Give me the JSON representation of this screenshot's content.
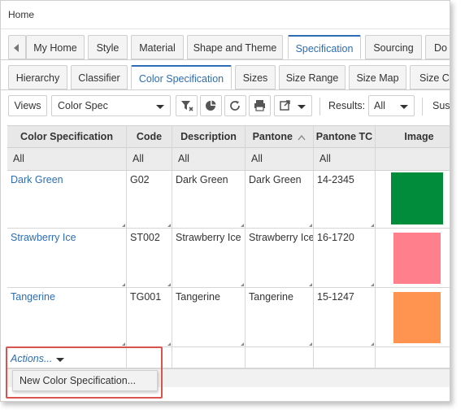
{
  "window": {
    "title": "Home"
  },
  "main_tabs": [
    {
      "label": "",
      "icon": "chevron-left-icon"
    },
    {
      "label": "My Home"
    },
    {
      "label": "Style"
    },
    {
      "label": "Material"
    },
    {
      "label": "Shape and Theme"
    },
    {
      "label": "Specification",
      "active": true
    },
    {
      "label": "Sourcing"
    },
    {
      "label": "Do"
    }
  ],
  "sub_tabs": [
    {
      "label": "Hierarchy"
    },
    {
      "label": "Classifier"
    },
    {
      "label": "Color Specification",
      "active": true
    },
    {
      "label": "Sizes"
    },
    {
      "label": "Size Range"
    },
    {
      "label": "Size Map"
    },
    {
      "label": "Size C"
    }
  ],
  "toolbar": {
    "views_label": "Views",
    "view_select_value": "Color Spec",
    "icons": [
      "clear-filter-icon",
      "pie-chart-icon",
      "refresh-icon",
      "print-icon",
      "export-icon"
    ],
    "results_label": "Results:",
    "results_value": "All",
    "truncated_label": "Sus"
  },
  "table": {
    "columns": [
      "Color Specification",
      "Code",
      "Description",
      "Pantone",
      "Pantone TC",
      "Image"
    ],
    "sorted_column": "Pantone",
    "sort_direction": "ascending",
    "filters": [
      "All",
      "All",
      "All",
      "All",
      "All",
      ""
    ],
    "rows": [
      {
        "name": "Dark Green",
        "code": "G02",
        "description": "Dark Green",
        "pantone": "Dark Green",
        "pantone_tc": "14-2345",
        "swatch_color": "#008c3a"
      },
      {
        "name": "Strawberry Ice",
        "code": "ST002",
        "description": "Strawberry Ice",
        "pantone": "Strawberry Ice",
        "pantone_tc": "16-1720",
        "swatch_color": "#ff7f8c"
      },
      {
        "name": "Tangerine",
        "code": "TG001",
        "description": "Tangerine",
        "pantone": "Tangerine",
        "pantone_tc": "15-1247",
        "swatch_color": "#ff9450"
      }
    ]
  },
  "actions": {
    "label": "Actions...",
    "menu_items": [
      "New Color Specification..."
    ]
  },
  "colors": {
    "accent": "#2e6db4",
    "highlight_border": "#d9534f"
  }
}
